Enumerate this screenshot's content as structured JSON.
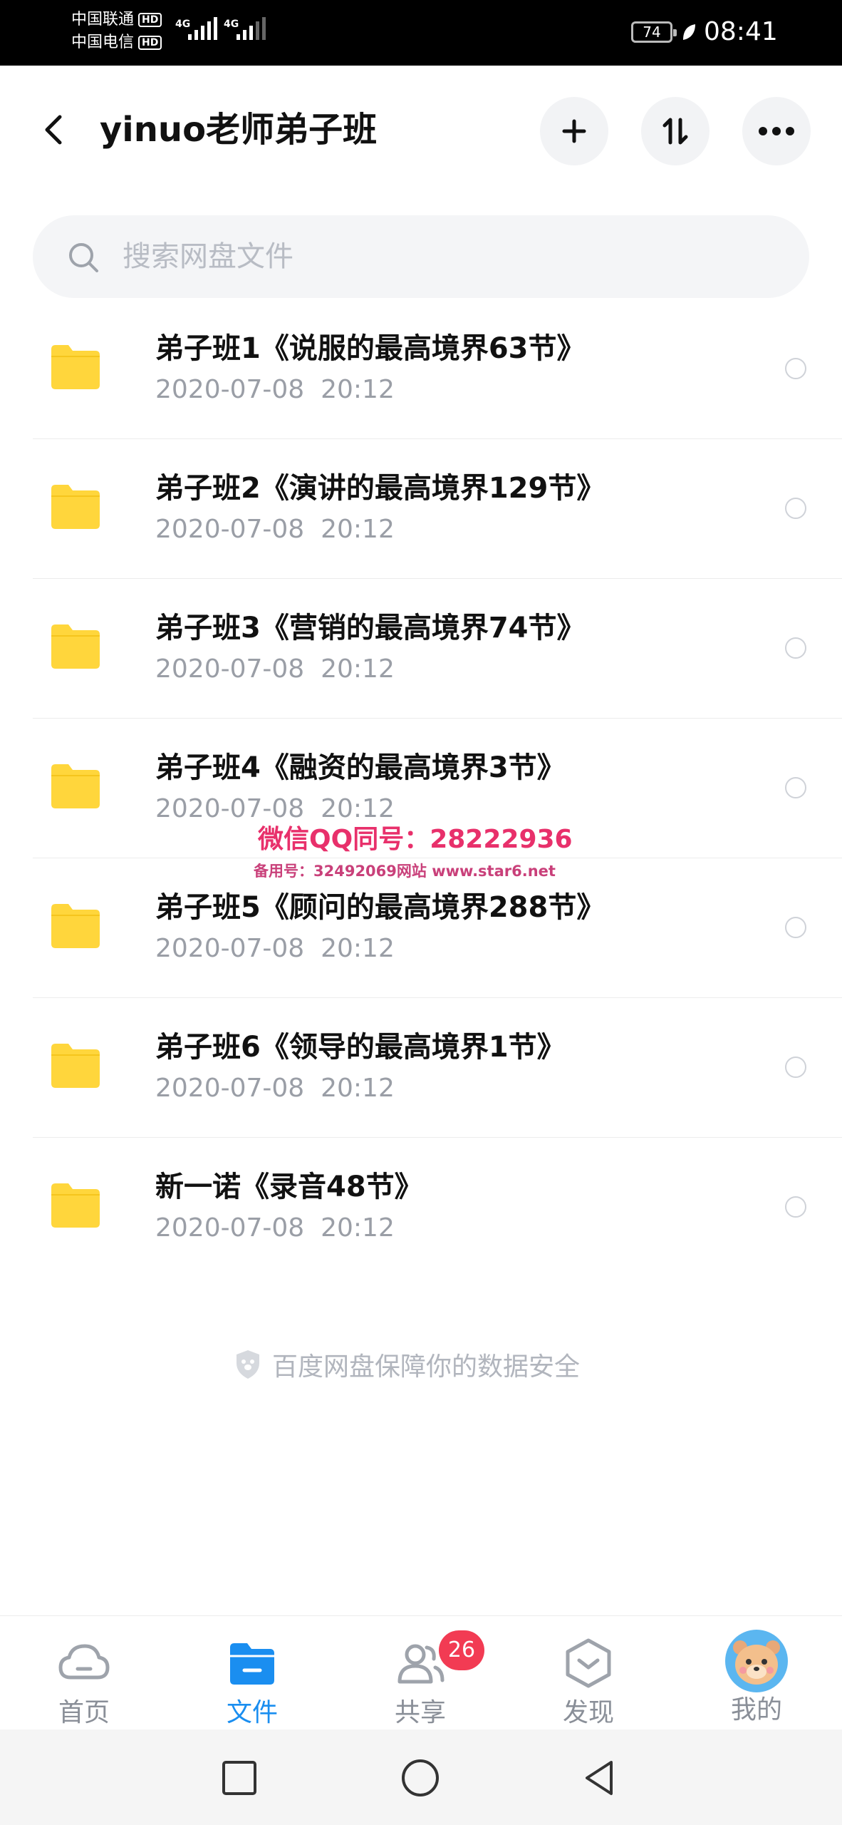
{
  "status_bar": {
    "carrier_1": "中国联通",
    "carrier_2": "中国电信",
    "hd_label": "HD",
    "net_1": "4G",
    "net_2": "4G",
    "battery": "74",
    "time": "08:41"
  },
  "header": {
    "title": "yinuo老师弟子班",
    "back_icon": "chevron-left-icon",
    "add_icon": "plus-icon",
    "sort_icon": "sort-arrows-icon",
    "more_icon": "more-dots-icon"
  },
  "search": {
    "placeholder": "搜索网盘文件",
    "icon": "search-icon"
  },
  "files": [
    {
      "name": "弟子班1《说服的最高境界63节》",
      "date": "2020-07-08  20:12"
    },
    {
      "name": "弟子班2《演讲的最高境界129节》",
      "date": "2020-07-08  20:12"
    },
    {
      "name": "弟子班3《营销的最高境界74节》",
      "date": "2020-07-08  20:12"
    },
    {
      "name": "弟子班4《融资的最高境界3节》",
      "date": "2020-07-08  20:12"
    },
    {
      "name": "弟子班5《顾问的最高境界288节》",
      "date": "2020-07-08  20:12"
    },
    {
      "name": "弟子班6《领导的最高境界1节》",
      "date": "2020-07-08  20:12"
    },
    {
      "name": "新一诺《录音48节》",
      "date": "2020-07-08  20:12"
    }
  ],
  "watermark": {
    "line_1": "微信QQ同号：28222936",
    "line_2": "备用号：32492069网站 www.star6.net"
  },
  "safety_note": "百度网盘保障你的数据安全",
  "bottom_nav": {
    "items": [
      {
        "label": "首页",
        "icon": "cloud-icon"
      },
      {
        "label": "文件",
        "icon": "folder-icon"
      },
      {
        "label": "共享",
        "icon": "people-icon"
      },
      {
        "label": "发现",
        "icon": "discover-icon"
      },
      {
        "label": "我的",
        "icon": "avatar"
      }
    ],
    "share_badge": "26",
    "active_index": 1
  },
  "colors": {
    "accent": "#1a8ef0",
    "folder": "#ffd63c",
    "badge": "#f23b53",
    "watermark": "#e8306b"
  }
}
